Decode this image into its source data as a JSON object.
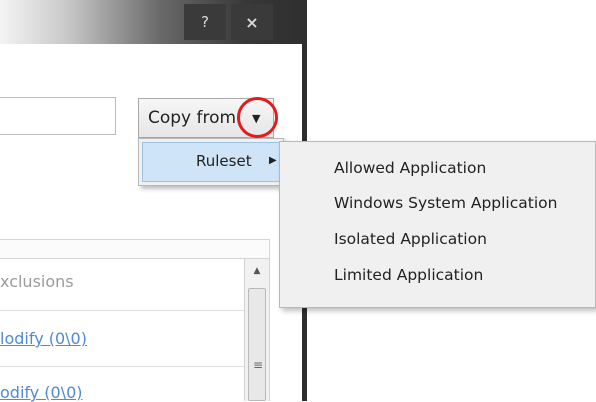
{
  "window": {
    "title_buttons": {
      "help": "?",
      "close": "×"
    }
  },
  "toolbar": {
    "copy_from_label": "Copy from",
    "dropdown_icon": "caret-down"
  },
  "menu": {
    "item_label": "Ruleset",
    "item_icon": "caret-right"
  },
  "submenu": {
    "items": [
      "Allowed Application",
      "Windows System Application",
      "Isolated Application",
      "Limited Application"
    ]
  },
  "list": {
    "header": "xclusions",
    "rows": [
      "lodify (0\\0)",
      "odify (0\\0)"
    ]
  },
  "colors": {
    "highlight": "#e21c1c",
    "link": "#4f8ad6",
    "menu_selected": "#cfe4f6"
  }
}
